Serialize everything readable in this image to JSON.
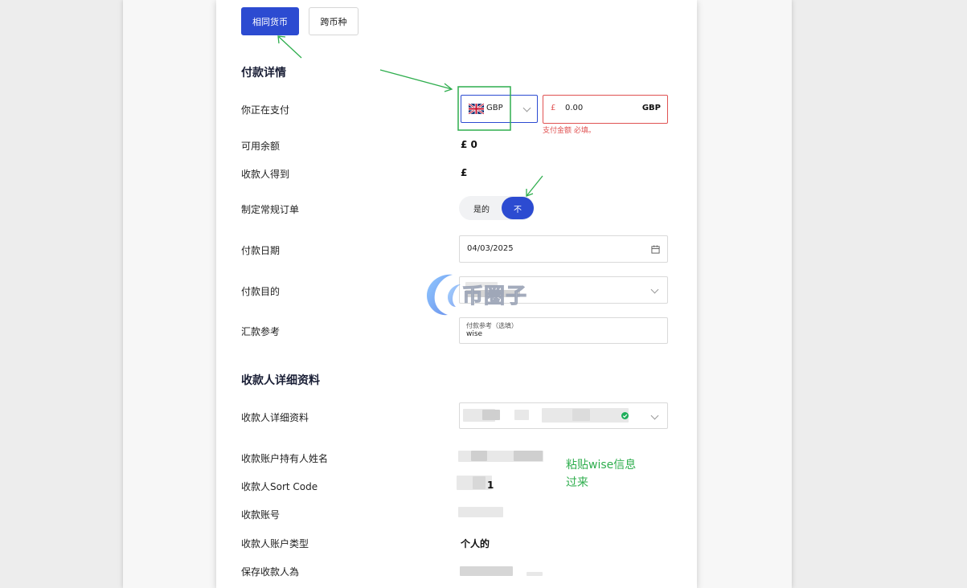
{
  "tabs": {
    "same_currency": "相同货币",
    "cross_currency": "跨币种"
  },
  "payment_details": {
    "section_title": "付款详情",
    "you_pay_label": "你正在支付",
    "currency_code": "GBP",
    "amount_symbol": "£",
    "amount_value": "0.00",
    "amount_currency": "GBP",
    "amount_error": "支付金额 必填。",
    "available_label": "可用余额",
    "available_value": "£ 0",
    "recipient_gets_label": "收款人得到",
    "recipient_gets_value": "£",
    "recurring_label": "制定常规订单",
    "recurring_yes": "是的",
    "recurring_no": "不",
    "date_label": "付款日期",
    "date_value": "04/03/2025",
    "purpose_label": "付款目的",
    "reference_label": "汇款参考",
    "reference_placeholder": "付款参考（选填）",
    "reference_value": "wise"
  },
  "recipient": {
    "section_title": "收款人详细资料",
    "details_label": "收款人详细资料",
    "holder_name_label": "收款账户持有人姓名",
    "sort_code_label": "收款人Sort Code",
    "sort_code_visible": "1",
    "account_number_label": "收款账号",
    "account_type_label": "收款人账户类型",
    "account_type_value": "个人的",
    "save_as_label": "保存收款人為"
  },
  "annotation": {
    "line1": "粘贴wise信息",
    "line2": "过来"
  },
  "watermark": {
    "text": "币圈子"
  },
  "colors": {
    "primary": "#2c4bd1",
    "error": "#e05252",
    "annotation_green": "#2fae4e",
    "verified_green": "#1fae5b"
  }
}
